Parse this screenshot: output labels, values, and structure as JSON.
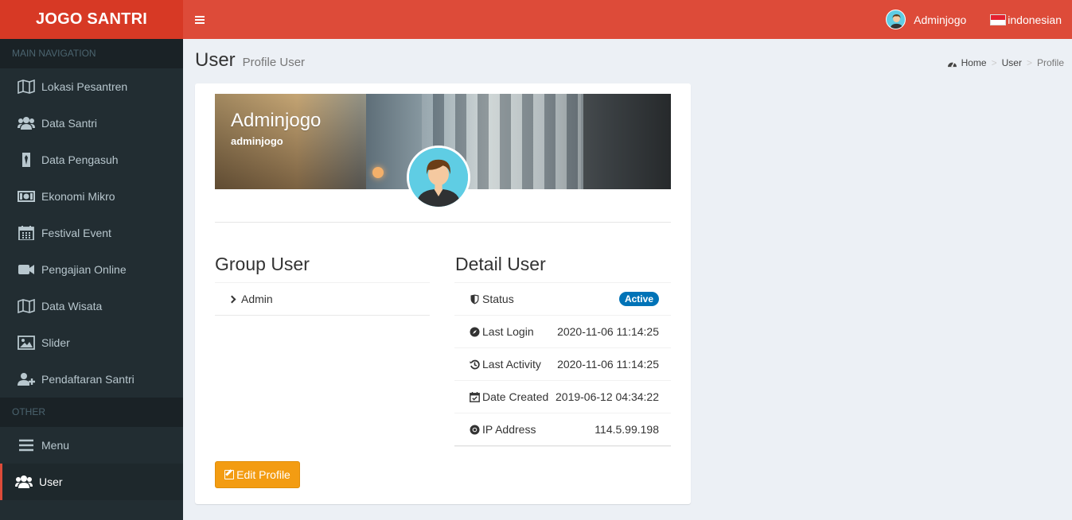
{
  "app": {
    "logo": "JOGO SANTRI"
  },
  "topbar": {
    "user_name": "Adminjogo",
    "language": "indonesian"
  },
  "sidebar": {
    "main_header": "MAIN NAVIGATION",
    "main_items": [
      {
        "label": "Lokasi Pesantren",
        "icon": "map-icon"
      },
      {
        "label": "Data Santri",
        "icon": "users-icon"
      },
      {
        "label": "Data Pengasuh",
        "icon": "tie-icon"
      },
      {
        "label": "Ekonomi Mikro",
        "icon": "money-icon"
      },
      {
        "label": "Festival Event",
        "icon": "calendar-icon"
      },
      {
        "label": "Pengajian Online",
        "icon": "video-camera-icon"
      },
      {
        "label": "Data Wisata",
        "icon": "map-icon"
      },
      {
        "label": "Slider",
        "icon": "image-icon"
      },
      {
        "label": "Pendaftaran Santri",
        "icon": "user-plus-icon"
      }
    ],
    "other_header": "OTHER",
    "other_items": [
      {
        "label": "Menu",
        "icon": "bars-icon"
      },
      {
        "label": "User",
        "icon": "users-icon",
        "active": true
      }
    ]
  },
  "content": {
    "title": "User",
    "subtitle": "Profile User",
    "breadcrumb": [
      "Home",
      "User",
      "Profile"
    ]
  },
  "profile": {
    "display_name": "Adminjogo",
    "username": "adminjogo",
    "group_title": "Group User",
    "groups": [
      "Admin"
    ],
    "detail_title": "Detail User",
    "details": [
      {
        "label": "Status",
        "value": "Active",
        "icon": "shield-icon",
        "is_badge": true
      },
      {
        "label": "Last Login",
        "value": "2020-11-06 11:14:25",
        "icon": "compass-icon"
      },
      {
        "label": "Last Activity",
        "value": "2020-11-06 11:14:25",
        "icon": "history-icon"
      },
      {
        "label": "Date Created",
        "value": "2019-06-12 04:34:22",
        "icon": "calendar-check-icon"
      },
      {
        "label": "IP Address",
        "value": "114.5.99.198",
        "icon": "chrome-icon"
      }
    ],
    "edit_button": "Edit Profile"
  },
  "colors": {
    "header": "#dd4b39",
    "logo_bg": "#d73925",
    "sidebar": "#222d32",
    "badge": "#0073b7",
    "edit_button": "#f39c12"
  }
}
